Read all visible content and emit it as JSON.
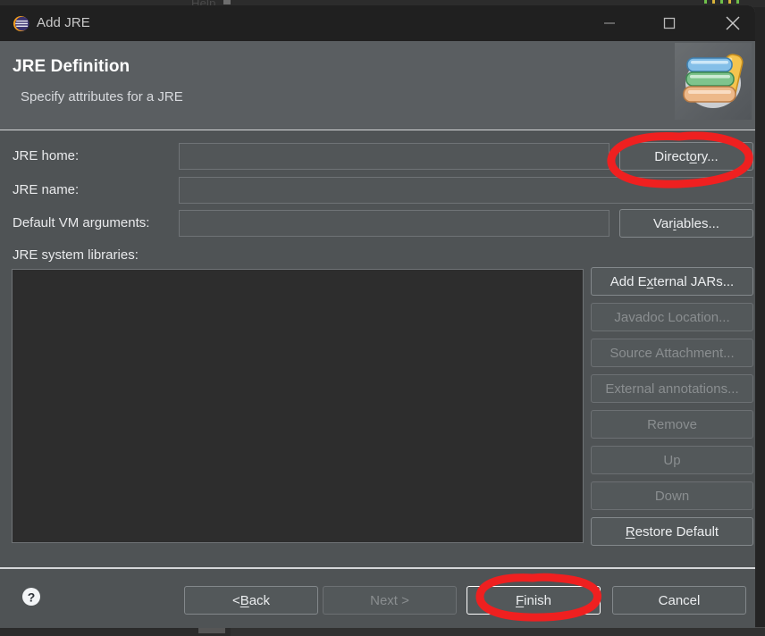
{
  "window": {
    "title": "Add JRE",
    "app_icon": "eclipse-icon",
    "controls": {
      "minimize": "minimize-icon",
      "maximize": "maximize-icon",
      "close": "close-icon"
    }
  },
  "header": {
    "title": "JRE Definition",
    "subtitle": "Specify attributes for a JRE",
    "icon": "books-icon"
  },
  "form": {
    "jre_home": {
      "label": "JRE home:",
      "value": "",
      "placeholder": ""
    },
    "jre_name": {
      "label": "JRE name:",
      "value": "",
      "placeholder": ""
    },
    "vm_args": {
      "label": "Default VM arguments:",
      "value": "",
      "placeholder": ""
    },
    "libraries": {
      "label": "JRE system libraries:",
      "items": []
    }
  },
  "side_buttons": [
    {
      "label": "Add External JARs...",
      "enabled": true,
      "mnemonic": "x"
    },
    {
      "label": "Javadoc Location...",
      "enabled": false,
      "mnemonic": ""
    },
    {
      "label": "Source Attachment...",
      "enabled": false,
      "mnemonic": ""
    },
    {
      "label": "External annotations...",
      "enabled": false,
      "mnemonic": ""
    },
    {
      "label": "Remove",
      "enabled": false,
      "mnemonic": ""
    },
    {
      "label": "Up",
      "enabled": false,
      "mnemonic": ""
    },
    {
      "label": "Down",
      "enabled": false,
      "mnemonic": ""
    },
    {
      "label": "Restore Default",
      "enabled": true,
      "mnemonic": "R"
    }
  ],
  "inline_buttons": {
    "directory": "Directory...",
    "variables": "Variables..."
  },
  "footer": {
    "help": "help-icon",
    "back": "< Back",
    "next": "Next >",
    "finish": "Finish",
    "cancel": "Cancel"
  },
  "annotations": {
    "color": "#ef2020",
    "marks": [
      {
        "target": "directory-button",
        "shape": "ellipse"
      },
      {
        "target": "finish-button",
        "shape": "ellipse"
      }
    ]
  },
  "colors": {
    "dialog_bg": "#4f5355",
    "header_bg": "#5a5e61",
    "titlebar_bg": "#202020",
    "listbox_bg": "#2d2d2d",
    "text": "#e9eaec",
    "disabled_text": "#8a8e90",
    "annotation_red": "#ef2020"
  },
  "background_app": {
    "menu_hint": "Help"
  }
}
